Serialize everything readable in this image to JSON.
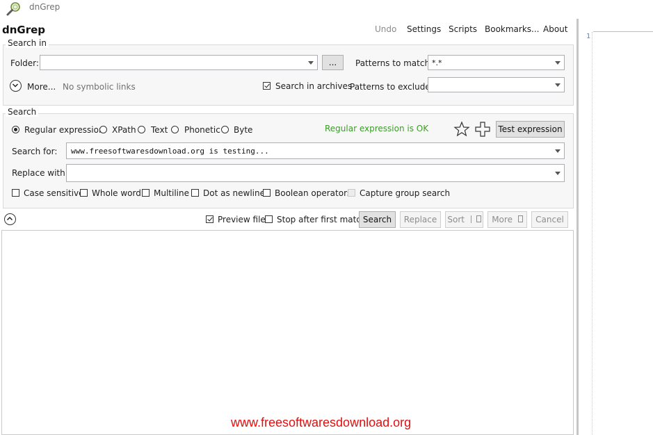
{
  "window": {
    "title": "dnGrep"
  },
  "app": {
    "name": "dnGrep"
  },
  "menu": {
    "undo": "Undo",
    "settings": "Settings",
    "scripts": "Scripts",
    "bookmarks": "Bookmarks...",
    "about": "About"
  },
  "search_in": {
    "group_label": "Search in",
    "folder_label": "Folder:",
    "folder_value": "",
    "browse_label": "...",
    "patterns_match_label": "Patterns to match:",
    "patterns_match_value": "*.*",
    "more_label": "More...",
    "symlinks_label": "No symbolic links",
    "search_archives_label": "Search in archives",
    "search_archives_checked": true,
    "patterns_exclude_label": "Patterns to exclude:",
    "patterns_exclude_value": ""
  },
  "search": {
    "group_label": "Search",
    "types": [
      "Regular expression",
      "XPath",
      "Text",
      "Phonetic",
      "Byte"
    ],
    "selected_type": "Regular expression",
    "status": "Regular expression is OK",
    "test_label": "Test expression",
    "search_for_label": "Search for:",
    "search_for_value": "www.freesoftwaresdownload.org is testing...",
    "replace_with_label": "Replace with:",
    "replace_with_value": "",
    "options": [
      "Case sensitive",
      "Whole word",
      "Multiline",
      "Dot as newline",
      "Boolean operators",
      "Capture group search"
    ]
  },
  "actions": {
    "preview_label": "Preview file",
    "preview_checked": true,
    "stop_first_label": "Stop after first match",
    "search_label": "Search",
    "replace_label": "Replace",
    "sort_label": "Sort",
    "more_label": "More",
    "cancel_label": "Cancel"
  },
  "editor": {
    "line_number": "1"
  },
  "watermark": "www.freesoftwaresdownload.org",
  "colors": {
    "status_ok": "#3c9a2a",
    "watermark": "#e01010"
  }
}
